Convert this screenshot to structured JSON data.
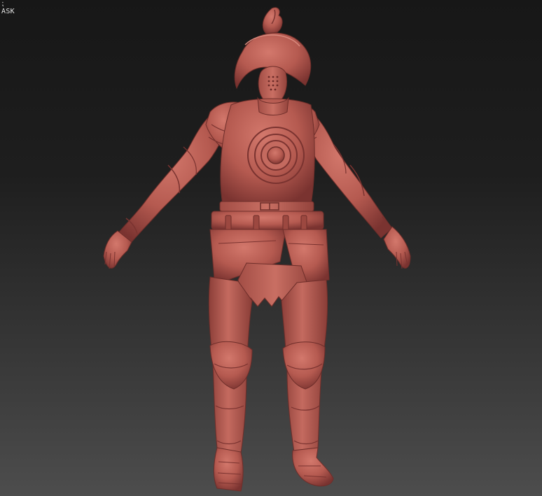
{
  "hud": {
    "line1": "⁏",
    "line2": "ASK"
  },
  "colors": {
    "clay": "#b55a50",
    "clay_dark": "#7a3330",
    "clay_light": "#d3786c",
    "bg_top": "#171717",
    "bg_bottom": "#4d4d4d"
  },
  "model": {
    "icon": "clay-armored-figure-icon"
  }
}
